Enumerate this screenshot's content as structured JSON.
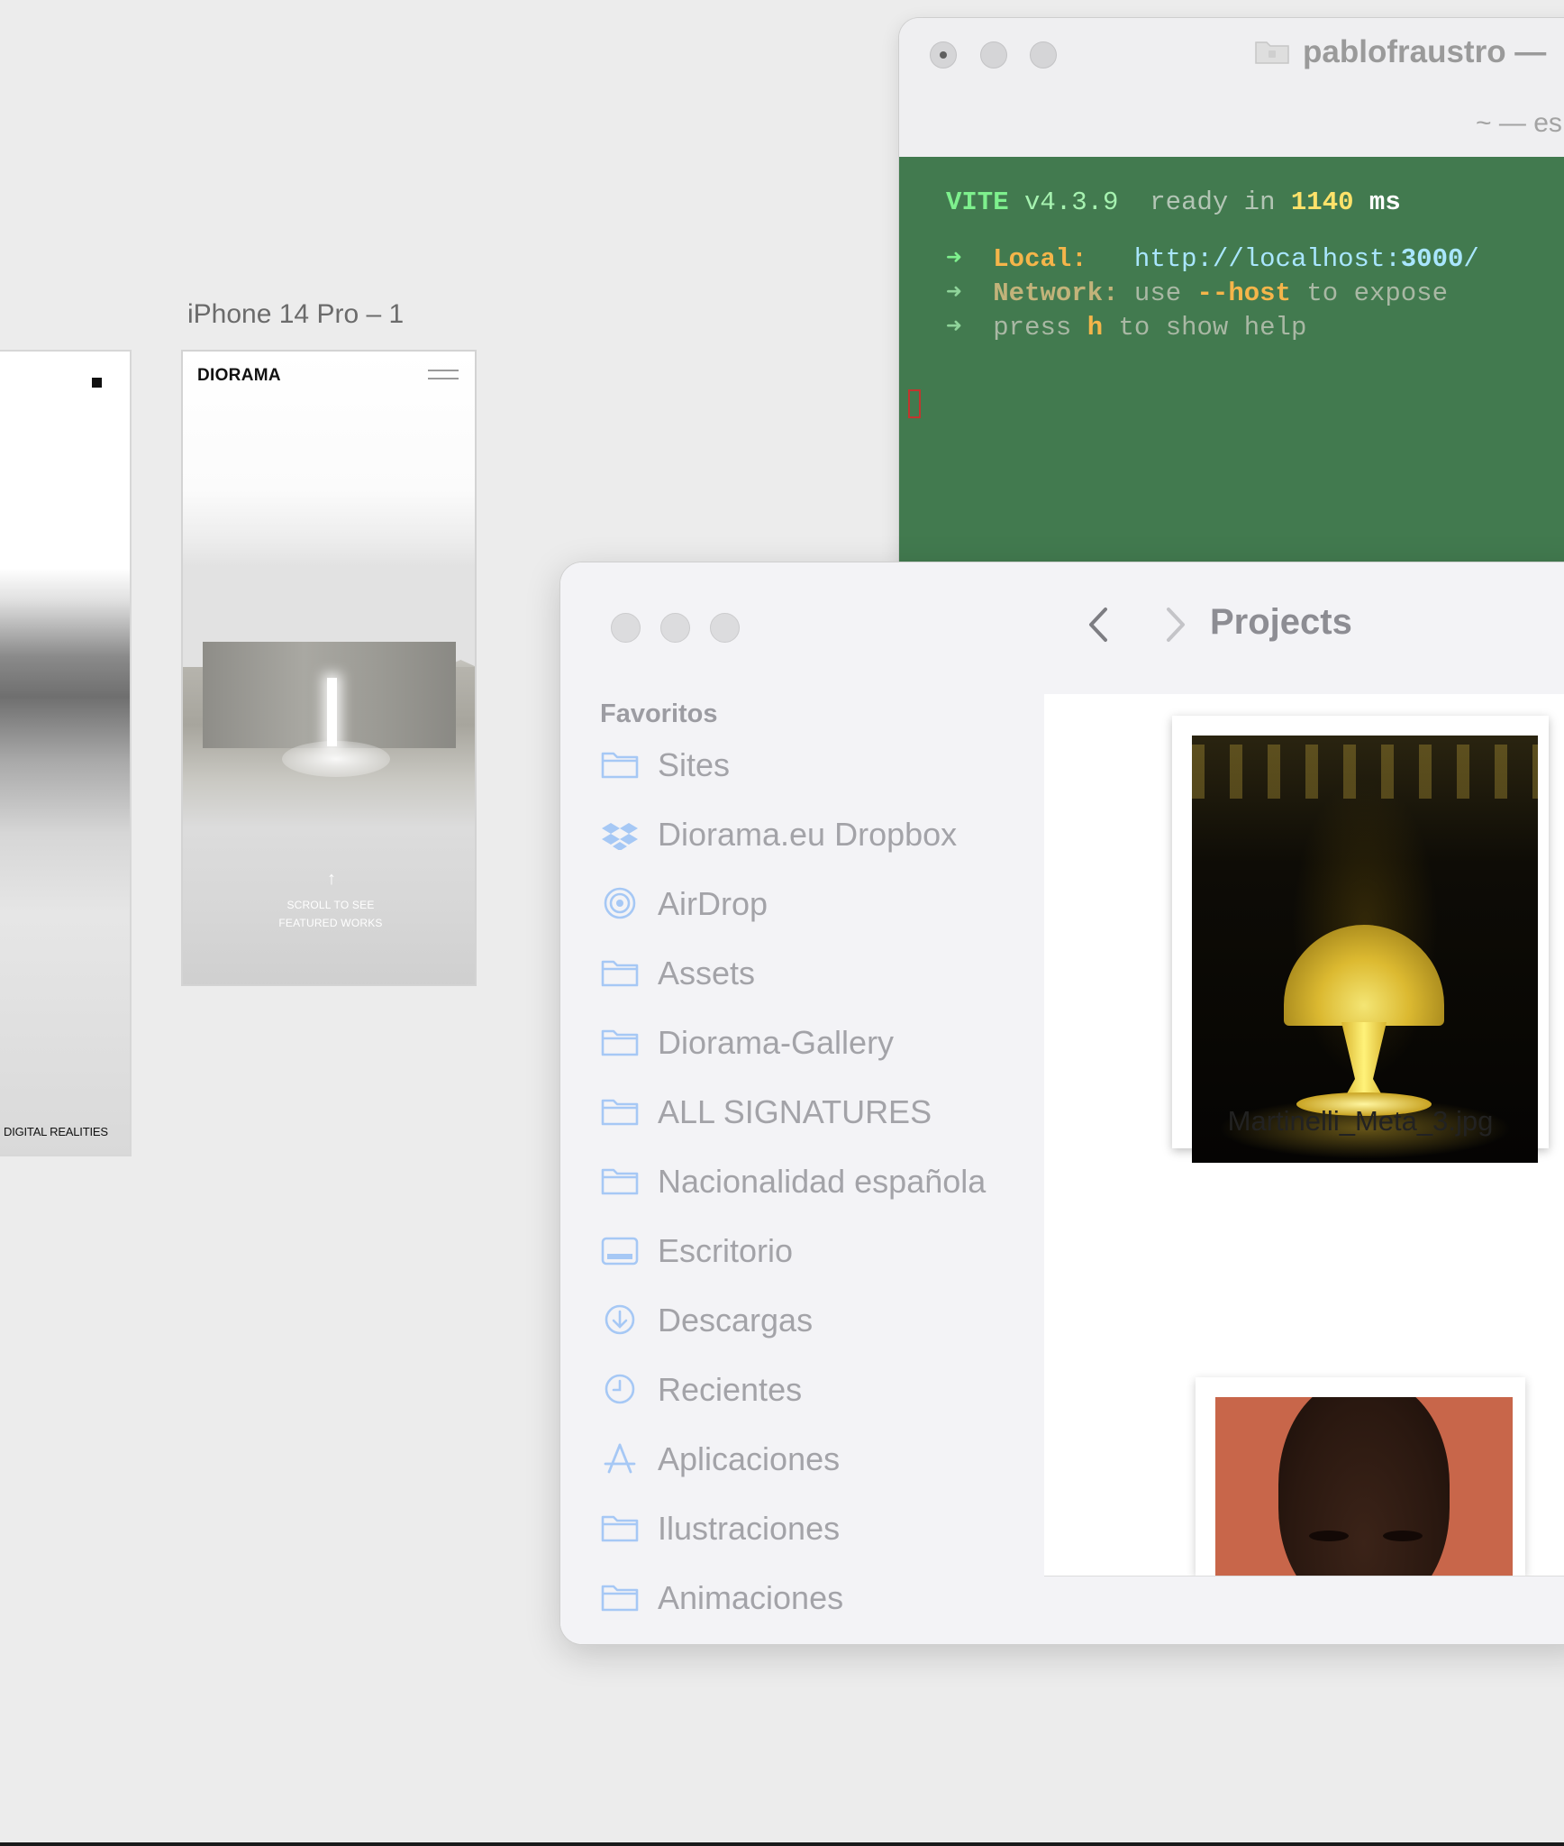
{
  "canvas": {
    "frame_label": "iPhone 14 Pro – 1",
    "left_frame": {
      "tagline": "DIGITAL REALITIES"
    },
    "phone": {
      "brand": "DIORAMA",
      "arrow": "↑",
      "scroll_line1": "SCROLL TO SEE",
      "scroll_line2": "FEATURED WORKS"
    }
  },
  "terminal": {
    "title": "pablofraustro —",
    "subtitle": "~ — es",
    "lines": {
      "vite": "VITE",
      "version": " v4.3.9",
      "ready": "  ready in ",
      "ms_value": "1140",
      "ms_unit": " ms",
      "arrow": "➜",
      "local_label": "Local:",
      "local_url_base": "http://localhost:",
      "local_url_port": "3000",
      "local_url_end": "/",
      "network_label": "Network:",
      "network_use": " use ",
      "network_flag": "--host",
      "network_rest": " to expose",
      "press": "press ",
      "press_key": "h",
      "press_rest": " to show help"
    }
  },
  "finder": {
    "favorites_heading": "Favoritos",
    "sidebar_items": [
      {
        "label": "Sites",
        "icon": "folder-icon"
      },
      {
        "label": "Diorama.eu Dropbox",
        "icon": "dropbox-icon"
      },
      {
        "label": "AirDrop",
        "icon": "airdrop-icon"
      },
      {
        "label": "Assets",
        "icon": "folder-icon"
      },
      {
        "label": "Diorama-Gallery",
        "icon": "folder-icon"
      },
      {
        "label": "ALL SIGNATURES",
        "icon": "folder-icon"
      },
      {
        "label": "Nacionalidad española",
        "icon": "folder-icon"
      },
      {
        "label": "Escritorio",
        "icon": "desktop-icon"
      },
      {
        "label": "Descargas",
        "icon": "download-icon"
      },
      {
        "label": "Recientes",
        "icon": "clock-icon"
      },
      {
        "label": "Aplicaciones",
        "icon": "applications-icon"
      },
      {
        "label": "Ilustraciones",
        "icon": "folder-icon"
      },
      {
        "label": "Animaciones",
        "icon": "folder-icon"
      }
    ],
    "folder_title": "Projects",
    "files": [
      {
        "name": "Martinelli_Meta_3.jpg"
      }
    ],
    "icon_color": "#a6c8f5"
  }
}
